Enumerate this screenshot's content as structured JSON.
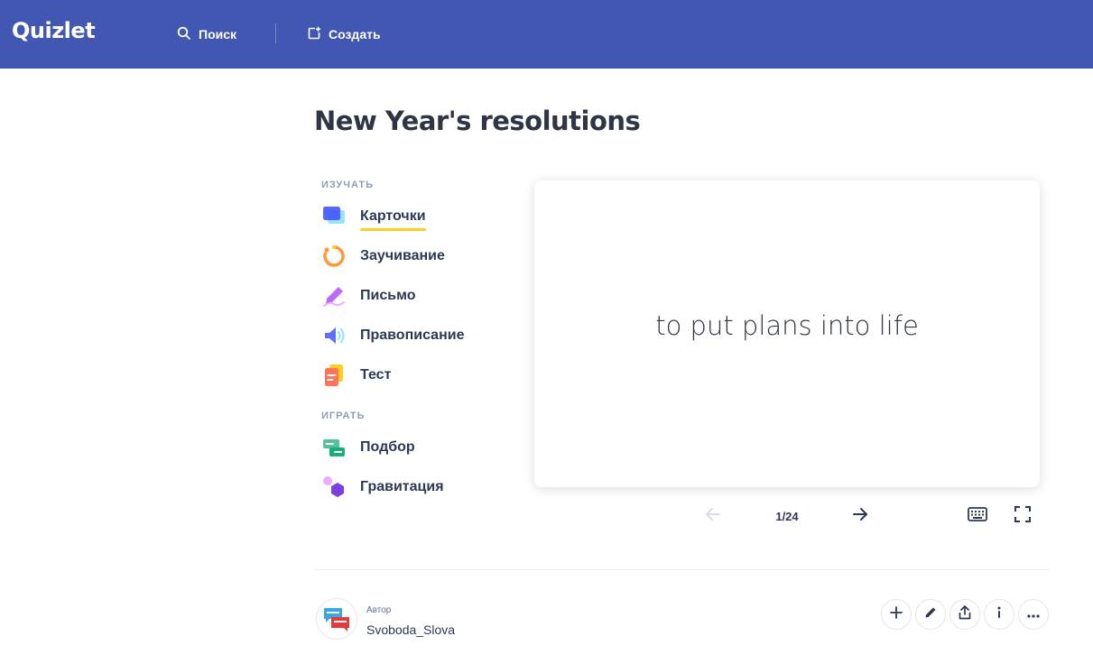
{
  "header": {
    "logo": "Quizlet",
    "search_label": "Поиск",
    "create_label": "Создать"
  },
  "set": {
    "title": "New Year's resolutions"
  },
  "sidebar": {
    "study_label": "ИЗУЧАТЬ",
    "play_label": "ИГРАТЬ",
    "study_modes": [
      {
        "label": "Карточки",
        "icon": "flashcards-icon",
        "active": true
      },
      {
        "label": "Заучивание",
        "icon": "learn-icon"
      },
      {
        "label": "Письмо",
        "icon": "write-icon"
      },
      {
        "label": "Правописание",
        "icon": "spell-icon"
      },
      {
        "label": "Тест",
        "icon": "test-icon"
      }
    ],
    "play_modes": [
      {
        "label": "Подбор",
        "icon": "match-icon"
      },
      {
        "label": "Гравитация",
        "icon": "gravity-icon"
      }
    ]
  },
  "card": {
    "term": "to put plans into life",
    "counter": "1/24"
  },
  "author": {
    "label": "Автор",
    "name": "Svoboda_Slova"
  },
  "colors": {
    "header_bg": "#4257b2",
    "active_underline": "#ffcd1f",
    "text": "#2e3856"
  }
}
